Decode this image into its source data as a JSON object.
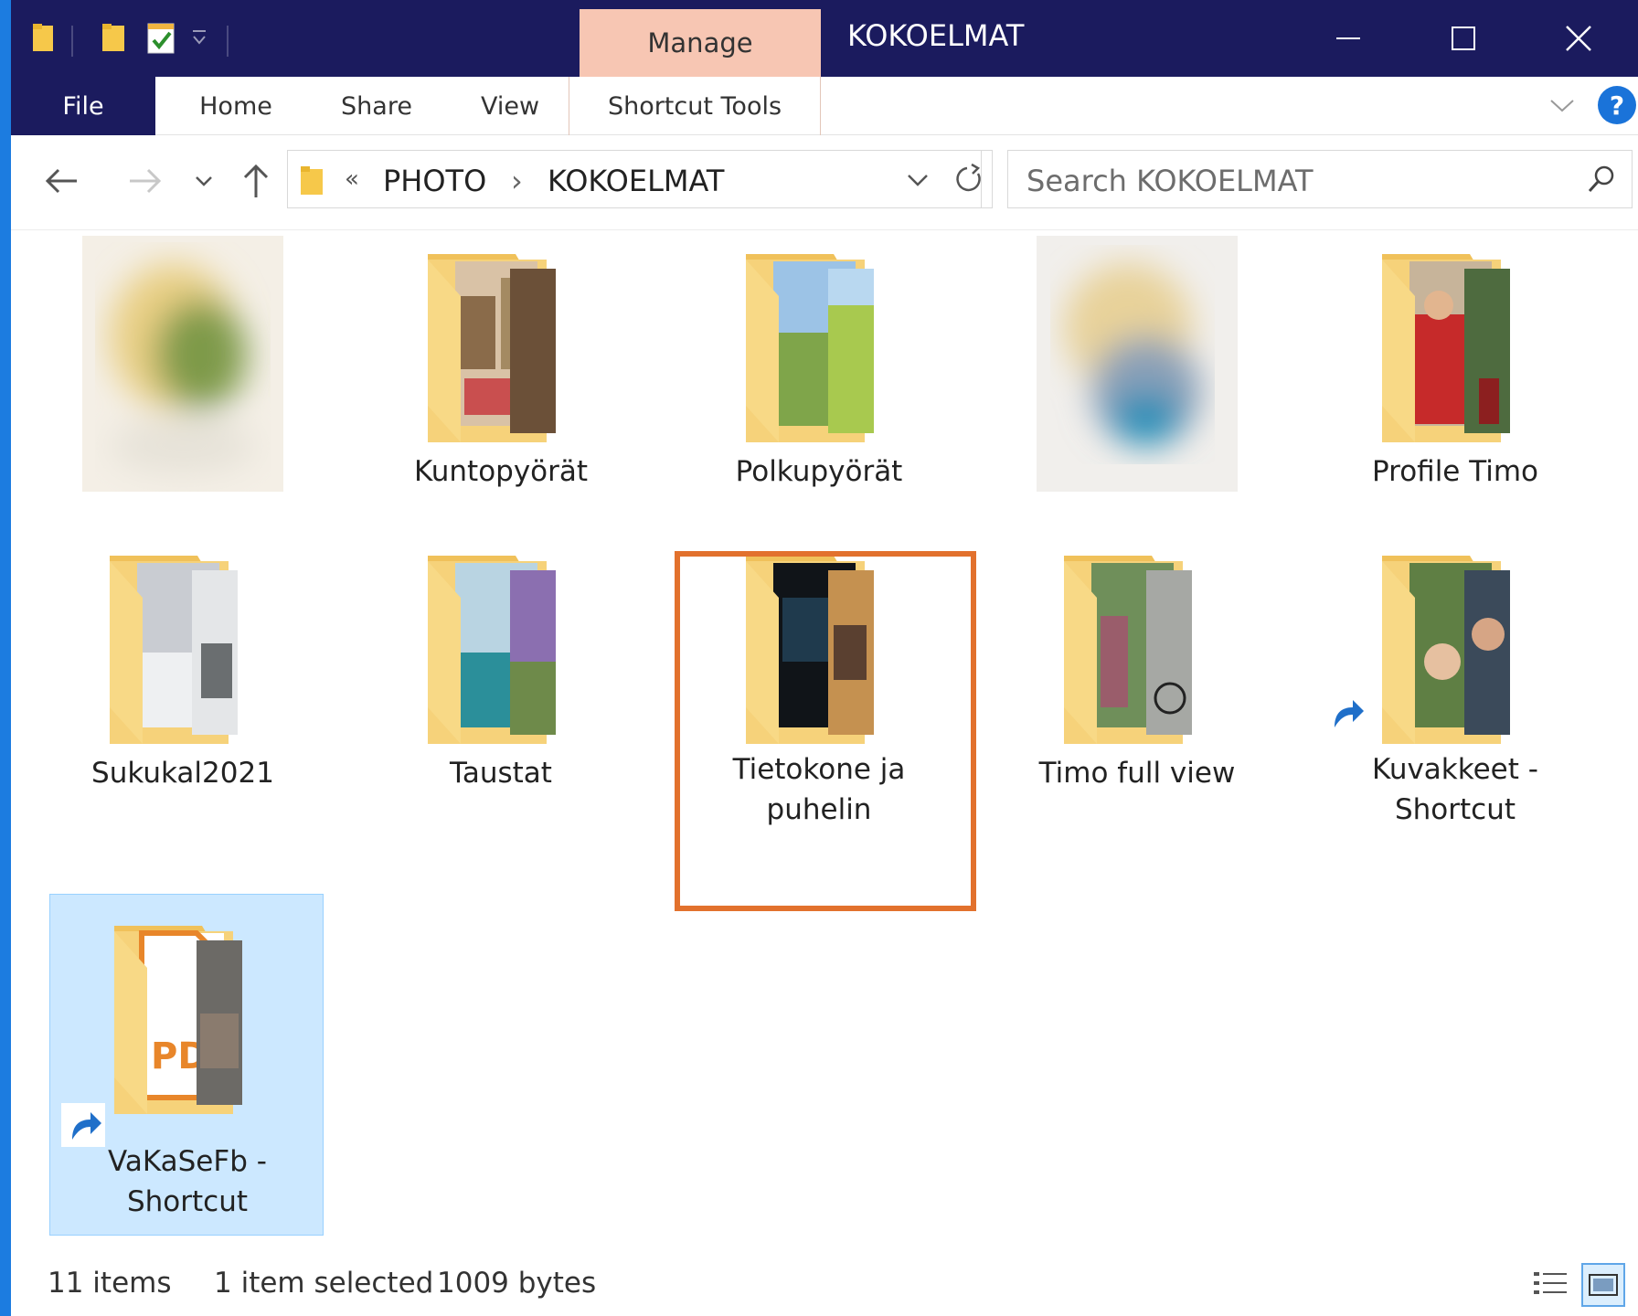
{
  "titlebar": {
    "contextual_tab": "Manage",
    "window_title": "KOKOELMAT",
    "buttons": [
      "minimize-icon",
      "maximize-icon",
      "close-icon"
    ]
  },
  "ribbon": {
    "tabs": [
      {
        "label": "File"
      },
      {
        "label": "Home"
      },
      {
        "label": "Share"
      },
      {
        "label": "View"
      },
      {
        "label": "Shortcut Tools"
      }
    ]
  },
  "address": {
    "overflow": "«",
    "crumbs": [
      "PHOTO",
      "KOKOELMAT"
    ],
    "separator": "›"
  },
  "search": {
    "placeholder": "Search KOKOELMAT"
  },
  "items": [
    {
      "name": "",
      "kind": "blurred-image"
    },
    {
      "name": "Kuntopyörät",
      "kind": "folder"
    },
    {
      "name": "Polkupyörät",
      "kind": "folder"
    },
    {
      "name": "",
      "kind": "blurred-image"
    },
    {
      "name": "Profile Timo",
      "kind": "folder"
    },
    {
      "name": "Sukukal2021",
      "kind": "folder"
    },
    {
      "name": "Taustat",
      "kind": "folder"
    },
    {
      "name": "Tietokone ja puhelin",
      "line1": "Tietokone ja",
      "line2": "puhelin",
      "kind": "folder",
      "highlighted": true
    },
    {
      "name": "Timo full view",
      "kind": "folder"
    },
    {
      "name": "Kuvakkeet - Shortcut",
      "line1": "Kuvakkeet -",
      "line2": "Shortcut",
      "kind": "folder-shortcut"
    },
    {
      "name": "VaKaSeFb - Shortcut",
      "line1": "VaKaSeFb -",
      "line2": "Shortcut",
      "kind": "folder-shortcut",
      "selected": true
    }
  ],
  "status": {
    "count": "11 items",
    "selection": "1 item selected",
    "size": "1009 bytes"
  },
  "colors": {
    "titlebar": "#1b1b5e",
    "manage_tab": "#f7c6b3",
    "selection": "#cce8ff",
    "highlight": "#e2712d",
    "accent": "#1c7ce0"
  }
}
